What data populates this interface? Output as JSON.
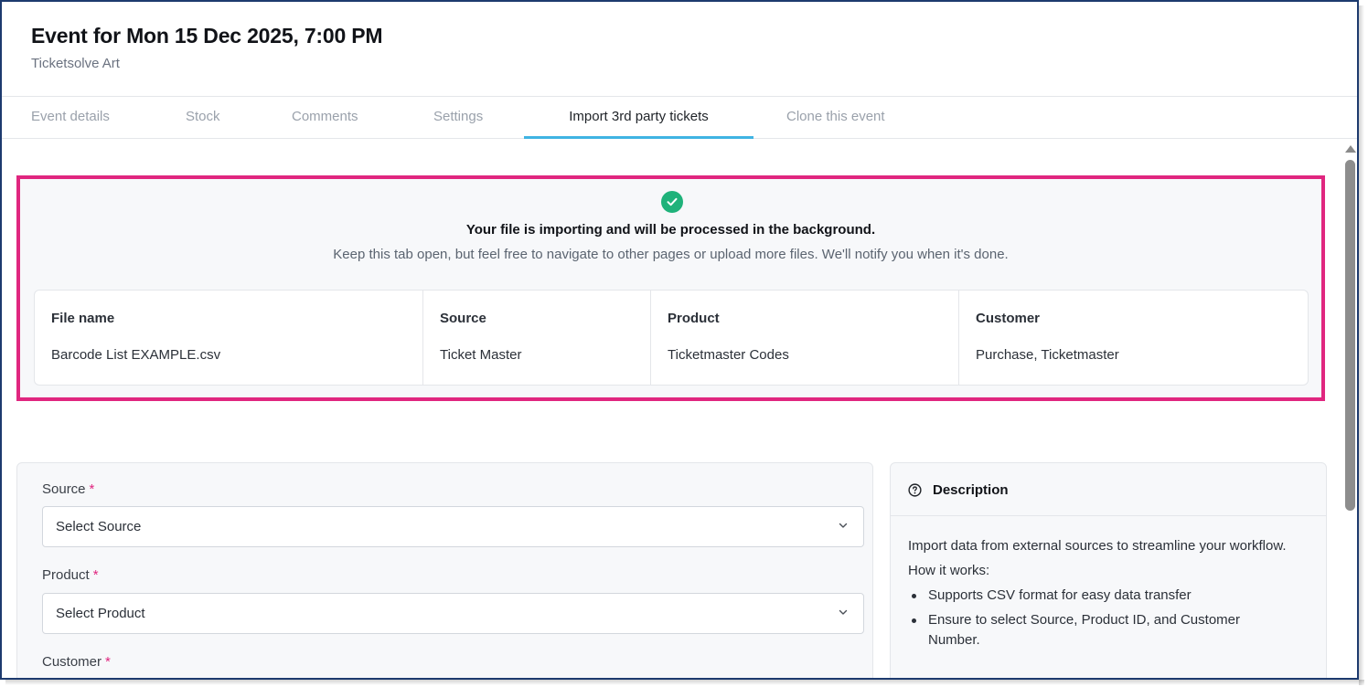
{
  "header": {
    "title": "Event for Mon 15 Dec 2025, 7:00 PM",
    "subtitle": "Ticketsolve Art"
  },
  "tabs": [
    {
      "label": "Event details",
      "active": false
    },
    {
      "label": "Stock",
      "active": false
    },
    {
      "label": "Comments",
      "active": false
    },
    {
      "label": "Settings",
      "active": false
    },
    {
      "label": "Import 3rd party tickets",
      "active": true
    },
    {
      "label": "Clone this event",
      "active": false
    }
  ],
  "notice": {
    "icon": "check-circle-icon",
    "title": "Your file is importing and will be processed in the background.",
    "body": "Keep this tab open, but feel free to navigate to other pages or upload more files. We'll notify you when it's done.",
    "highlight_color": "#e0267f",
    "success_color": "#1fb27a"
  },
  "file_table": {
    "columns": [
      {
        "header": "File name",
        "value": "Barcode List EXAMPLE.csv"
      },
      {
        "header": "Source",
        "value": "Ticket Master"
      },
      {
        "header": "Product",
        "value": "Ticketmaster Codes"
      },
      {
        "header": "Customer",
        "value": "Purchase, Ticketmaster"
      }
    ]
  },
  "form": {
    "source": {
      "label": "Source",
      "required_mark": "*",
      "placeholder": "Select Source"
    },
    "product": {
      "label": "Product",
      "required_mark": "*",
      "placeholder": "Select Product"
    },
    "customer": {
      "label": "Customer",
      "required_mark": "*"
    }
  },
  "description": {
    "icon": "question-circle-icon",
    "title": "Description",
    "intro": "Import data from external sources to streamline your workflow.",
    "how_title": "How it works:",
    "bullets": [
      "Supports CSV format for easy data transfer",
      "Ensure to select Source, Product ID, and Customer Number."
    ]
  },
  "colors": {
    "accent_tab": "#3fb4e3",
    "required": "#e0267f"
  }
}
